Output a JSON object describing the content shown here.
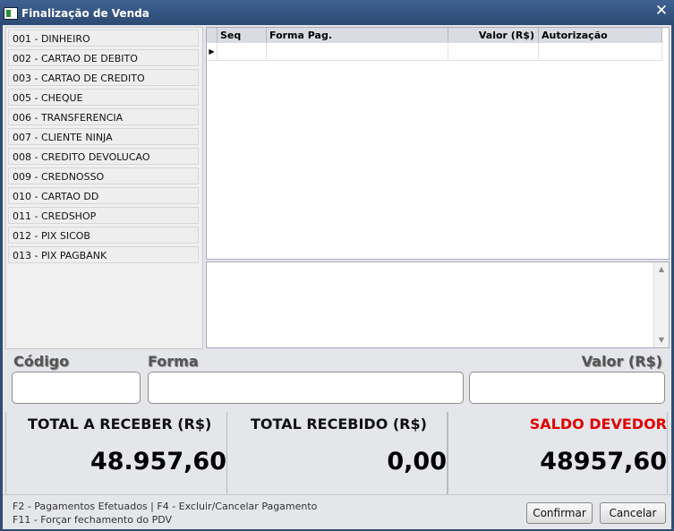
{
  "window": {
    "title": "Finalização de Venda",
    "close_glyph": "✕"
  },
  "payment_methods": [
    "001 - DINHEIRO",
    "002 - CARTAO DE DEBITO",
    "003 - CARTAO DE CREDITO",
    "005 - CHEQUE",
    "006 - TRANSFERENCIA",
    "007 - CLIENTE NINJA",
    "008 - CREDITO DEVOLUCAO",
    "009 - CREDNOSSO",
    "010 - CARTAO DD",
    "011 - CREDSHOP",
    "012 - PIX SICOB",
    "013 - PIX PAGBANK"
  ],
  "grid": {
    "columns": [
      "Seq",
      "Forma Pag.",
      "Valor (R$)",
      "Autorização"
    ],
    "row_indicator": "▶"
  },
  "fields": {
    "codigo_label": "Código",
    "forma_label": "Forma",
    "valor_label": "Valor (R$)"
  },
  "totals": {
    "receber_label": "TOTAL A RECEBER (R$)",
    "receber_value": "48.957,60",
    "recebido_label": "TOTAL RECEBIDO (R$)",
    "recebido_value": "0,00",
    "saldo_label": "SALDO DEVEDOR",
    "saldo_value": "48957,60",
    "saldo_color": "#e00000"
  },
  "footer": {
    "hint1": "F2 - Pagamentos Efetuados | F4 - Excluir/Cancelar Pagamento",
    "hint2": "F11 - Forçar fechamento do PDV",
    "confirm_label": "Confirmar",
    "cancel_label": "Cancelar"
  }
}
